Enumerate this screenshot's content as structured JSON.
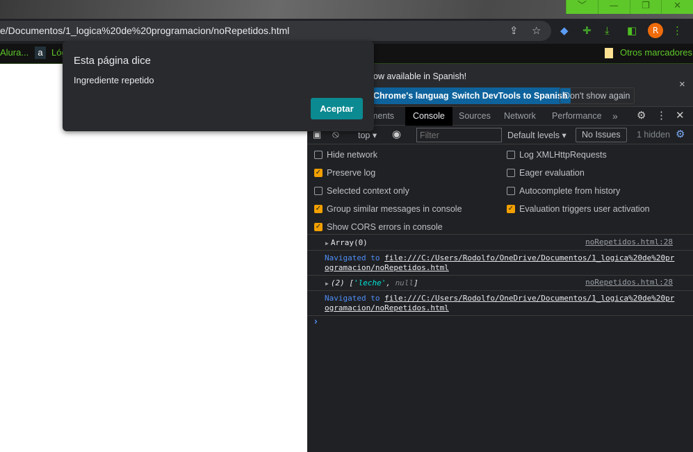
{
  "window": {
    "controls": [
      "﹀",
      "—",
      "❐",
      "✕"
    ]
  },
  "address_bar": {
    "url": "e/Documentos/1_logica%20de%20programacion/noRepetidos.html",
    "avatar_letter": "R"
  },
  "bookmarks": {
    "items": [
      "Alura...",
      "Lóg"
    ],
    "other": "Otros marcadores"
  },
  "dialog": {
    "title": "Esta página dice",
    "message": "Ingrediente repetido",
    "ok": "Aceptar"
  },
  "devtools": {
    "infobar": {
      "text": "ow available in Spanish!",
      "btn1": "Chrome's language",
      "btn2": "Switch DevTools to Spanish",
      "btn3": "Don't show again",
      "close": "×"
    },
    "tabs": [
      "ments",
      "Console",
      "Sources",
      "Network",
      "Performance"
    ],
    "more": "»",
    "toolbar": {
      "context": "top ▾",
      "filter_placeholder": "Filter",
      "levels": "Default levels ▾",
      "issues": "No Issues",
      "hidden": "1 hidden"
    },
    "settings": {
      "left": [
        {
          "label": "Hide network",
          "checked": false
        },
        {
          "label": "Preserve log",
          "checked": true
        },
        {
          "label": "Selected context only",
          "checked": false
        },
        {
          "label": "Group similar messages in console",
          "checked": true
        },
        {
          "label": "Show CORS errors in console",
          "checked": true
        }
      ],
      "right": [
        {
          "label": "Log XMLHttpRequests",
          "checked": false
        },
        {
          "label": "Eager evaluation",
          "checked": false
        },
        {
          "label": "Autocomplete from history",
          "checked": false
        },
        {
          "label": "Evaluation triggers user activation",
          "checked": true
        }
      ]
    },
    "console": {
      "log1": "Array(0)",
      "source": "noRepetidos.html:28",
      "nav_label": "Navigated to",
      "nav_url1": "file:///C:/Users/Rodolfo/OneDrive/Documentos/1_logica%20de%20pr",
      "nav_url2": "ogramacion/noRepetidos.html",
      "log2_prefix": "(2) [",
      "log2_str": "'leche'",
      "log2_sep": ", ",
      "log2_null": "null",
      "log2_end": "]",
      "prompt": "›"
    }
  }
}
